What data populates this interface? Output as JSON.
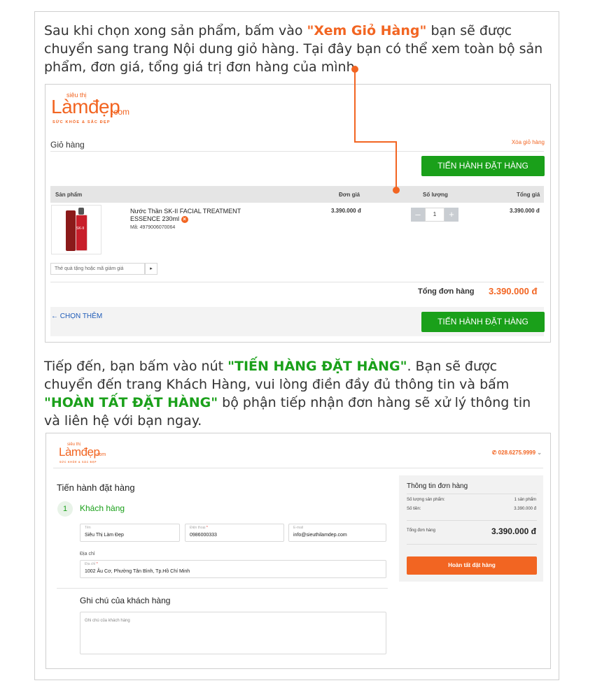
{
  "intro1": {
    "before": "Sau khi chọn xong sản phẩm, bấm vào ",
    "highlight": "\"Xem Giỏ Hàng\"",
    "after": " bạn sẽ được chuyển sang trang Nội dung giỏ hàng. Tại đây bạn có thể xem toàn bộ sản phẩm, đơn giá, tổng giá trị đơn hàng của mình."
  },
  "intro2": {
    "before": "Tiếp đến, bạn bấm vào nút ",
    "highlight1": "\"TIẾN HÀNG ĐẶT HÀNG\"",
    "middle": ". Bạn sẽ được chuyển đến trang Khách Hàng, vui lòng điền đầy đủ thông tin và bấm ",
    "highlight2": "\"HOÀN TẤT ĐẶT HÀNG\"",
    "after": " bộ phận tiếp nhận đơn hàng sẽ xử lý thông tin và liên hệ với bạn ngay."
  },
  "logo": {
    "small": "siêu thị",
    "big": "Làmđẹp",
    "domain": ".com",
    "tagline": "SỨC KHỎE & SẮC ĐẸP"
  },
  "cart": {
    "title": "Giỏ hàng",
    "clear": "Xóa giỏ hàng",
    "checkout_label": "TIẾN HÀNH ĐẶT HÀNG",
    "columns": {
      "product": "Sản phẩm",
      "unit_price": "Đơn giá",
      "quantity": "Số lượng",
      "total": "Tổng giá"
    },
    "item": {
      "name": "Nước Thần SK-II FACIAL TREATMENT ESSENCE 230ml",
      "sku": "Mã: 4979006070064",
      "unit_price": "3.390.000 đ",
      "quantity": "1",
      "total": "3.390.000 đ",
      "image_brand": "SK-II"
    },
    "coupon_placeholder": "Thẻ quà tặng hoặc mã giảm giá",
    "coupon_btn": "▸",
    "order_total_label": "Tổng đơn hàng",
    "order_total": "3.390.000 đ",
    "more": "← CHỌN THÊM"
  },
  "checkout": {
    "hotline": "028.6275.9999",
    "title": "Tiến hành đặt hàng",
    "step_num": "1",
    "step_label": "Khách hàng",
    "name_label": "Tên",
    "name_value": "Siêu Thị Làm Đẹp",
    "phone_label": "Điện thoại",
    "phone_value": "0986000333",
    "email_label": "E-mail",
    "email_value": "info@sieuthilamdep.com",
    "address_section": "Địa chỉ",
    "address_label": "Địa chỉ",
    "address_value": "1002 Âu Cơ, Phường Tân Bình, Tp.Hồ Chí Minh",
    "note_title": "Ghi chú của khách hàng",
    "note_placeholder": "Ghi chú của khách hàng"
  },
  "summary": {
    "title": "Thông tin đơn hàng",
    "qty_label": "Số lượng sản phẩm:",
    "qty_value": "1 sản phẩm",
    "subtotal_label": "Số tiền:",
    "subtotal_value": "3.390.000 đ",
    "total_label": "Tổng đơn hàng",
    "total_value": "3.390.000 đ",
    "place_order": "Hoàn tất đặt hàng"
  },
  "colors": {
    "brand_orange": "#f26522",
    "green": "#1aa01a",
    "link_blue": "#1e5bb8"
  }
}
